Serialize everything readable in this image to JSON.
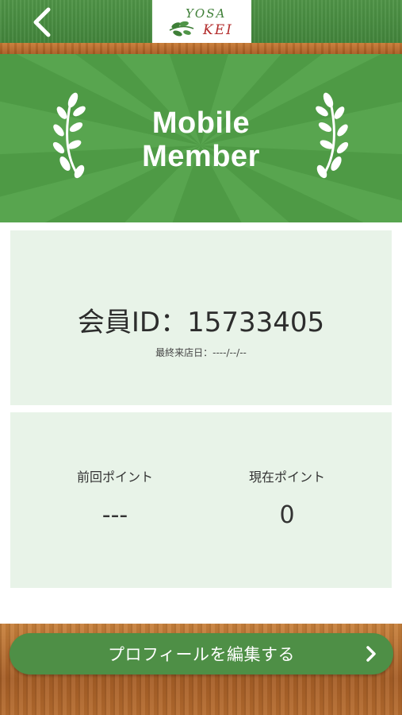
{
  "header": {
    "back_icon": "chevron-left-icon",
    "logo_line1": "YOSA",
    "logo_line2": "KEI"
  },
  "banner": {
    "title_line1": "Mobile",
    "title_line2": "Member",
    "icon": "laurel-icon"
  },
  "member": {
    "id_label": "会員ID：",
    "id_value": "15733405",
    "last_visit_label": "最終来店日：",
    "last_visit_value": "----/--/--"
  },
  "points": {
    "previous_label": "前回ポイント",
    "previous_value": "---",
    "current_label": "現在ポイント",
    "current_value": "0"
  },
  "footer": {
    "edit_profile_label": "プロフィールを編集する",
    "chevron_icon": "chevron-right-icon"
  },
  "colors": {
    "primary_green": "#4e9a45",
    "panel_bg": "#e8f3e8",
    "wood": "#b56b2e",
    "button_green": "#4e8f46"
  }
}
